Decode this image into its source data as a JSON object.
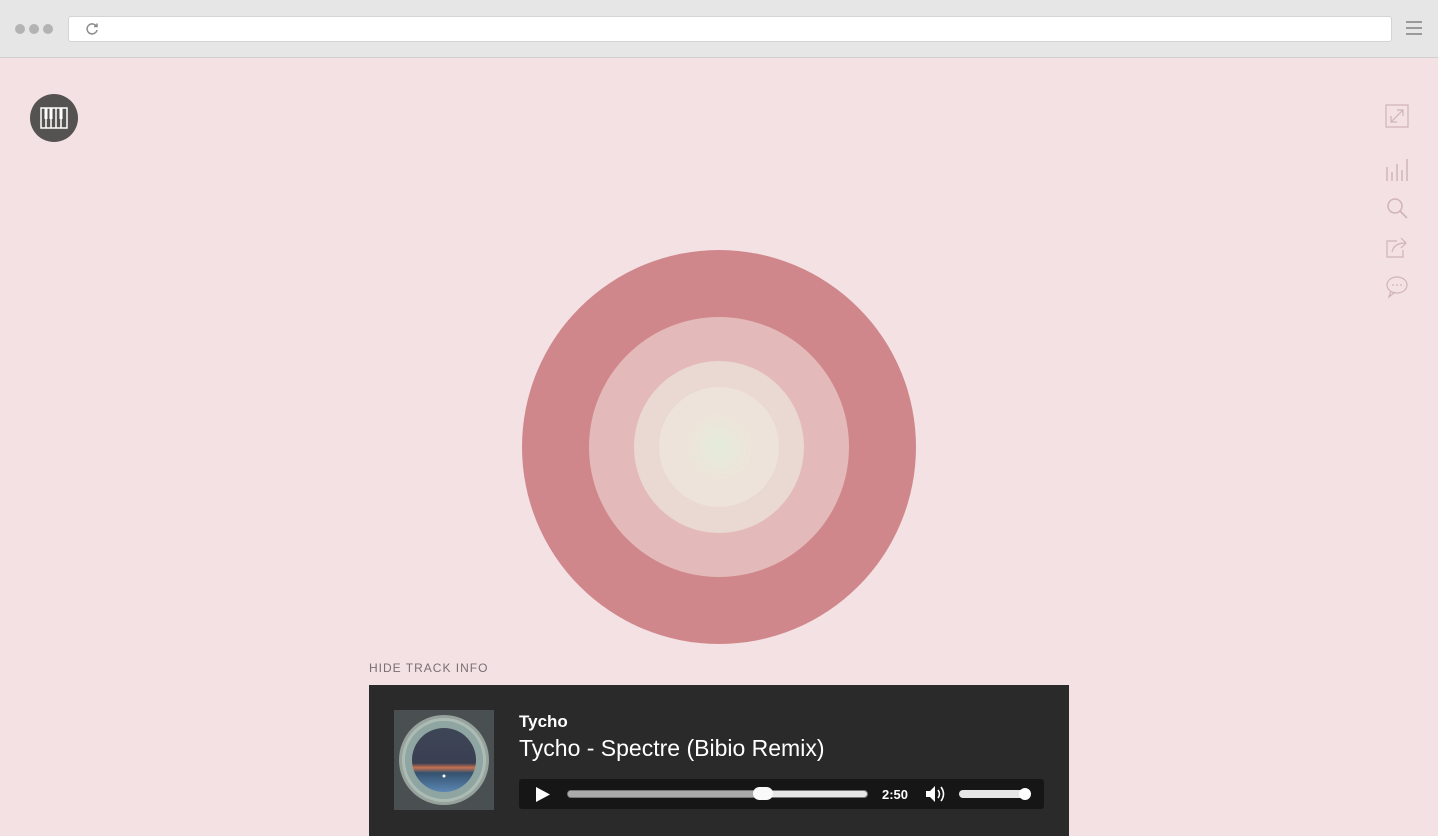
{
  "browser": {
    "reload_icon": "reload-icon",
    "menu_icon": "hamburger-menu-icon"
  },
  "app": {
    "logo_icon": "piano-keys-icon",
    "side_icons": [
      "fullscreen-icon",
      "visualizer-icon",
      "search-icon",
      "share-icon",
      "comment-icon"
    ]
  },
  "visualizer": {
    "colors": [
      "#d0878b",
      "#e3bab9",
      "#ead8d3",
      "#eee3da"
    ]
  },
  "track_info": {
    "toggle_label": "HIDE TRACK INFO",
    "artist": "Tycho",
    "title": "Tycho - Spectre (Bibio Remix)",
    "player": {
      "time": "2:50",
      "progress_fraction": 0.65,
      "volume_fraction": 1.0
    }
  }
}
